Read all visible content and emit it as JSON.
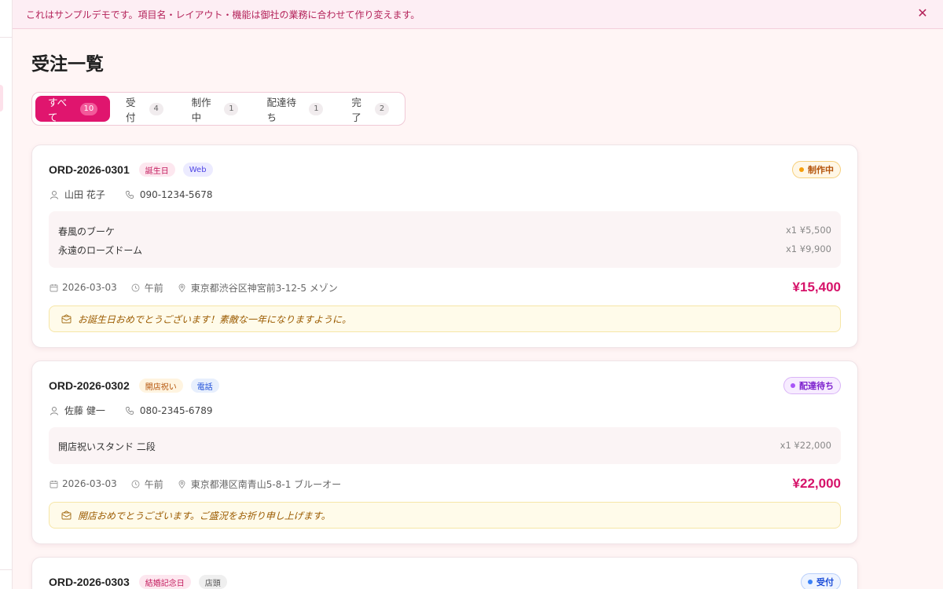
{
  "banner": {
    "text": "これはサンプルデモです。項目名・レイアウト・機能は御社の業務に合わせて作り変えます。",
    "close_label": "✕"
  },
  "page": {
    "title": "受注一覧"
  },
  "tabs": [
    {
      "label": "すべて",
      "count": "10",
      "active": true
    },
    {
      "label": "受付",
      "count": "4"
    },
    {
      "label": "制作中",
      "count": "1"
    },
    {
      "label": "配達待ち",
      "count": "1"
    },
    {
      "label": "完了",
      "count": "2"
    }
  ],
  "orders": [
    {
      "id": "ORD-2026-0301",
      "tags": [
        {
          "label": "誕生日",
          "color": "#c2185b",
          "bg": "#fde7ef"
        },
        {
          "label": "Web",
          "color": "#4f46e5",
          "bg": "#ecebff"
        }
      ],
      "status": {
        "label": "制作中",
        "color": "#b45309",
        "bg": "#fff7e6",
        "border": "#f6cf7a",
        "dot": "#f59e0b"
      },
      "customer_name": "山田 花子",
      "phone": "090-1234-5678",
      "items": [
        {
          "name": "春風のブーケ",
          "qty": "x1 ¥5,500"
        },
        {
          "name": "永遠のローズドーム",
          "qty": "x1 ¥9,900"
        }
      ],
      "date": "2026-03-03",
      "time": "午前",
      "address": "東京都渋谷区神宮前3-12-5 メゾン",
      "total": "¥15,400",
      "message": "お誕生日おめでとうございます！素敵な一年になりますように。"
    },
    {
      "id": "ORD-2026-0302",
      "tags": [
        {
          "label": "開店祝い",
          "color": "#b45309",
          "bg": "#fff4e0"
        },
        {
          "label": "電話",
          "color": "#1d4ed8",
          "bg": "#e7effd"
        }
      ],
      "status": {
        "label": "配達待ち",
        "color": "#7e22ce",
        "bg": "#f7ecff",
        "border": "#d9b4f7",
        "dot": "#a855f7"
      },
      "customer_name": "佐藤 健一",
      "phone": "080-2345-6789",
      "items": [
        {
          "name": "開店祝いスタンド 二段",
          "qty": "x1 ¥22,000"
        }
      ],
      "date": "2026-03-03",
      "time": "午前",
      "address": "東京都港区南青山5-8-1 ブルーオー",
      "total": "¥22,000",
      "message": "開店おめでとうございます。ご盛況をお祈り申し上げます。"
    },
    {
      "id": "ORD-2026-0303",
      "tags": [
        {
          "label": "結婚記念日",
          "color": "#c2185b",
          "bg": "#fde7ef"
        },
        {
          "label": "店頭",
          "color": "#555555",
          "bg": "#efefef"
        }
      ],
      "status": {
        "label": "受付",
        "color": "#1d4ed8",
        "bg": "#eef4ff",
        "border": "#b9cffb",
        "dot": "#3b82f6"
      }
    }
  ],
  "icons": {
    "user": "user-icon",
    "phone": "phone-icon",
    "calendar": "calendar-icon",
    "clock": "clock-icon",
    "location": "location-pin-icon",
    "message": "message-card-icon",
    "close": "close-icon"
  }
}
